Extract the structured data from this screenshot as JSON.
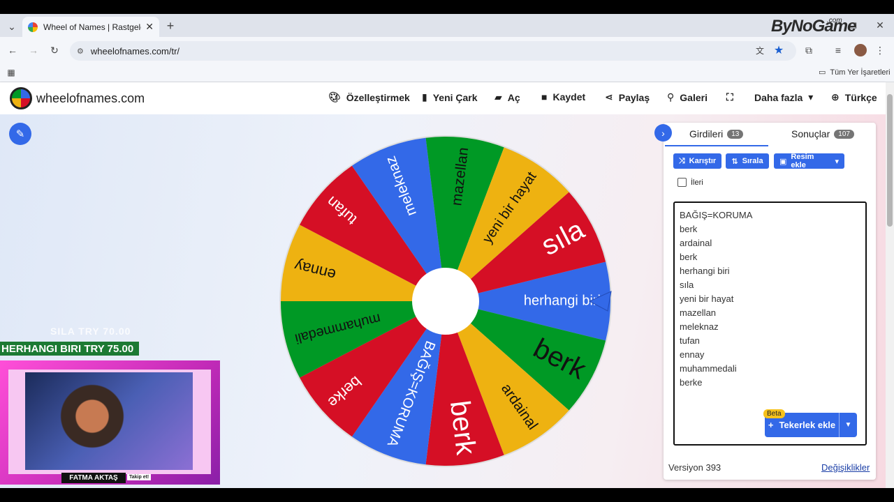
{
  "browser": {
    "tab_title": "Wheel of Names | Rastgele ad s",
    "url": "wheelofnames.com/tr/",
    "bookmarks_label": "Tüm Yer İşaretleri"
  },
  "site": {
    "name": "wheelofnames.com",
    "nav": {
      "customize": "Özelleştirmek",
      "new": "Yeni Çark",
      "open": "Aç",
      "save": "Kaydet",
      "share": "Paylaş",
      "gallery": "Galeri",
      "more": "Daha fazla",
      "language": "Türkçe"
    }
  },
  "wheel": {
    "slices": [
      {
        "label": "herhangi biri",
        "color": "#3369e8"
      },
      {
        "label": "berk",
        "color": "#009925"
      },
      {
        "label": "ardainal",
        "color": "#eeb211"
      },
      {
        "label": "berk",
        "color": "#d50f25"
      },
      {
        "label": "BAĞIŞ=KORUMA",
        "color": "#3369e8"
      },
      {
        "label": "berke",
        "color": "#d50f25"
      },
      {
        "label": "muhammedali",
        "color": "#009925"
      },
      {
        "label": "ennay",
        "color": "#eeb211"
      },
      {
        "label": "tufan",
        "color": "#d50f25"
      },
      {
        "label": "meleknaz",
        "color": "#3369e8"
      },
      {
        "label": "mazellan",
        "color": "#009925"
      },
      {
        "label": "yeni bir hayat",
        "color": "#eeb211"
      },
      {
        "label": "sıla",
        "color": "#d50f25"
      }
    ]
  },
  "panel": {
    "tab_entries": "Girdileri",
    "entries_count": "13",
    "tab_results": "Sonuçlar",
    "results_count": "107",
    "shuffle": "Karıştır",
    "sort": "Sırala",
    "add_image": "Resim ekle",
    "advanced": "İleri",
    "entries": [
      "BAĞIŞ=KORUMA",
      "berk",
      "ardainal",
      "berk",
      "herhangi biri",
      "sıla",
      "yeni bir hayat",
      "mazellan",
      "meleknaz",
      "tufan",
      "ennay",
      "muhammedali",
      "berke"
    ],
    "beta": "Beta",
    "add_wheel": "Tekerlek ekle",
    "version": "Versiyon 393",
    "changes": "Değişiklikler"
  },
  "overlay": {
    "line1": "SILA  TRY 70.00",
    "line2": "HERHANGI BIRI  TRY 75.00",
    "streamer": "FATMA AKTAŞ",
    "follow": "Takip et!",
    "watermark": "ByNoGame",
    "watermark_com": ".com"
  }
}
